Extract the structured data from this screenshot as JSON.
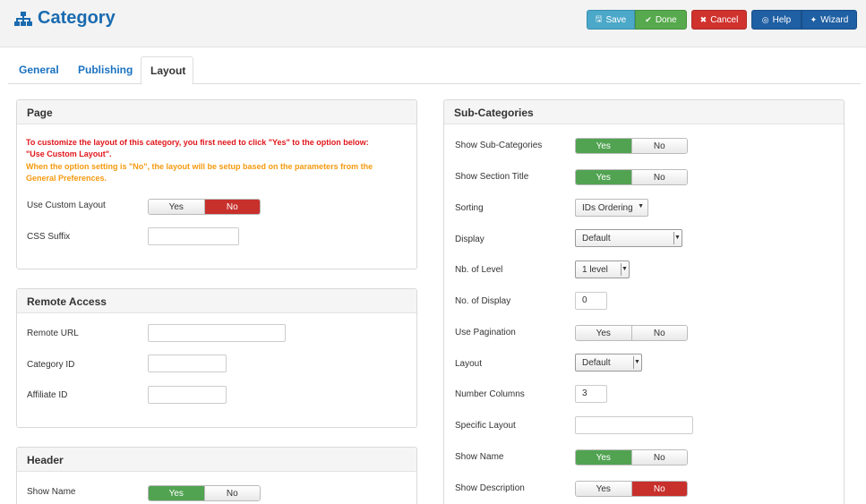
{
  "header": {
    "title": "Category"
  },
  "toolbar": {
    "save": "Save",
    "done": "Done",
    "cancel": "Cancel",
    "help": "Help",
    "wizard": "Wizard"
  },
  "tabs": [
    "General",
    "Publishing",
    "Layout"
  ],
  "page_panel": {
    "title": "Page",
    "warning_red_1": "To customize the layout of this category, you first need to click \"Yes\" to the option below:",
    "warning_red_2": "\"Use Custom Layout\".",
    "warning_orange_1": "When the option setting is \"No\", the layout will be setup based on the parameters from the",
    "warning_orange_2": "General Preferences.",
    "use_custom_layout": {
      "label": "Use Custom Layout",
      "yes": "Yes",
      "no": "No",
      "value": "No"
    },
    "css_suffix": {
      "label": "CSS Suffix",
      "value": ""
    }
  },
  "remote_panel": {
    "title": "Remote Access",
    "remote_url": {
      "label": "Remote URL",
      "value": ""
    },
    "category_id": {
      "label": "Category ID",
      "value": ""
    },
    "affiliate_id": {
      "label": "Affiliate ID",
      "value": ""
    }
  },
  "header_panel": {
    "title": "Header",
    "show_name": {
      "label": "Show Name",
      "yes": "Yes",
      "no": "No",
      "value": "Yes"
    }
  },
  "subcat_panel": {
    "title": "Sub-Categories",
    "show_subcategories": {
      "label": "Show Sub-Categories",
      "yes": "Yes",
      "no": "No",
      "value": "Yes"
    },
    "show_section_title": {
      "label": "Show Section Title",
      "yes": "Yes",
      "no": "No",
      "value": "Yes"
    },
    "sorting": {
      "label": "Sorting",
      "value": "IDs Ordering"
    },
    "display": {
      "label": "Display",
      "value": "Default"
    },
    "nb_of_level": {
      "label": "Nb. of Level",
      "value": "1 level"
    },
    "no_of_display": {
      "label": "No. of Display",
      "value": "0"
    },
    "use_pagination": {
      "label": "Use Pagination",
      "yes": "Yes",
      "no": "No",
      "value": "none"
    },
    "layout": {
      "label": "Layout",
      "value": "Default"
    },
    "number_columns": {
      "label": "Number Columns",
      "value": "3"
    },
    "specific_layout": {
      "label": "Specific Layout",
      "value": ""
    },
    "show_name": {
      "label": "Show Name",
      "yes": "Yes",
      "no": "No",
      "value": "Yes"
    },
    "show_description": {
      "label": "Show Description",
      "yes": "Yes",
      "no": "No",
      "value": "No"
    }
  },
  "colors": {
    "accent": "#1a6bb0",
    "yes_on": "#51a351",
    "no_on": "#c8302c",
    "warning_red": "#e0161b",
    "warning_orange": "#f59a0f"
  }
}
